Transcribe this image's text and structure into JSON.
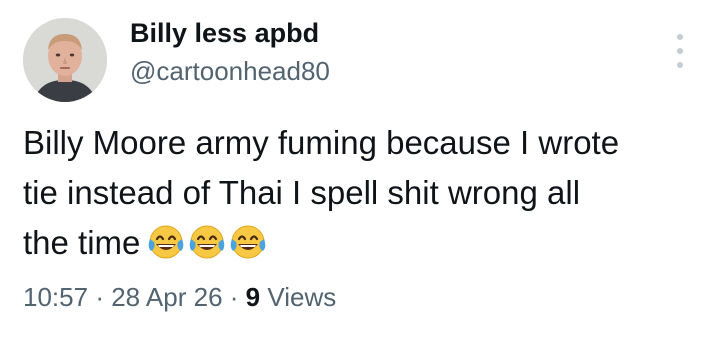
{
  "author": {
    "display_name": "Billy less apbd",
    "handle": "@cartoonhead80"
  },
  "tweet": {
    "line1": "Billy Moore army fuming because I wrote",
    "line2": "tie instead of Thai I spell shit wrong all",
    "line3": "the time",
    "emojis": [
      "face-with-tears-of-joy",
      "face-with-tears-of-joy",
      "face-with-tears-of-joy"
    ]
  },
  "meta": {
    "time": "10:57",
    "sep1": "·",
    "date": "28 Apr 26",
    "sep2": "·",
    "views_count": "9",
    "views_label": "Views"
  },
  "colors": {
    "text_primary": "#0f1419",
    "text_secondary": "#536471",
    "more_dots": "#c7ccd1"
  },
  "icons": {
    "more": "vertical-ellipsis"
  }
}
